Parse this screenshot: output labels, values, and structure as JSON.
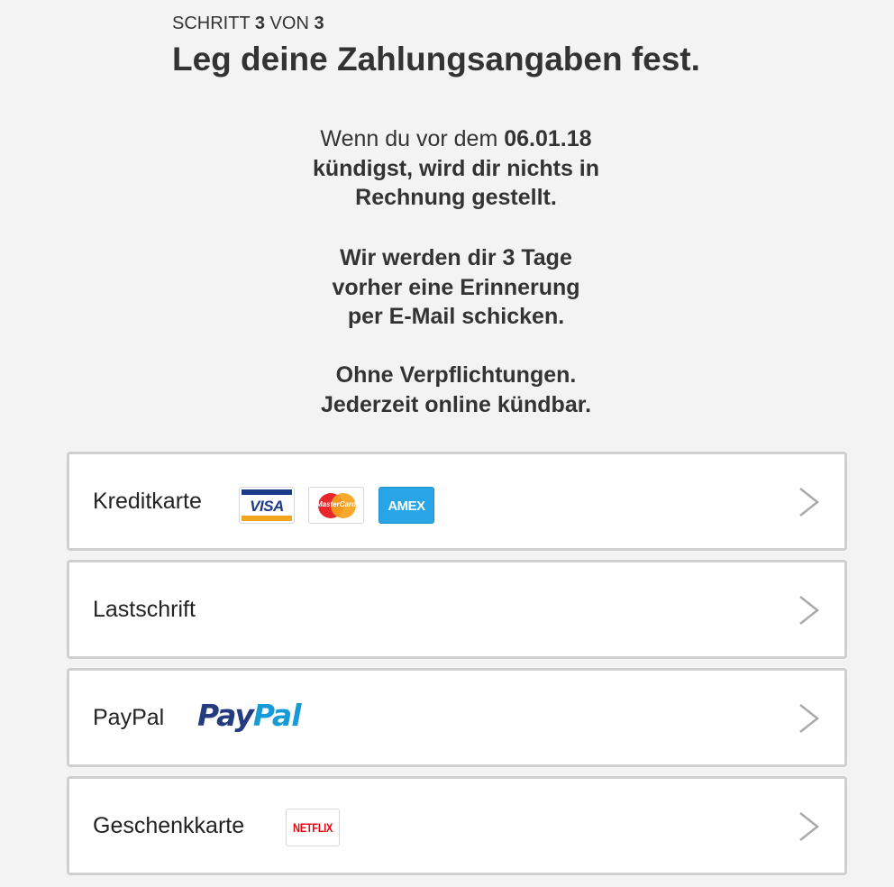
{
  "header": {
    "step_prefix": "SCHRITT ",
    "step_current": "3",
    "step_middle": " VON ",
    "step_total": "3",
    "title": "Leg deine Zahlungsangaben fest."
  },
  "info": {
    "line1_pre": "Wenn du vor dem ",
    "line1_date": "06.01.18",
    "line2": "kündigst, wird dir nichts in",
    "line3": "Rechnung gestellt.",
    "reminder_line1": "Wir werden dir 3 Tage",
    "reminder_line2": "vorher eine Erinnerung",
    "reminder_line3": "per E-Mail schicken.",
    "commit_line1": "Ohne Verpflichtungen.",
    "commit_line2": "Jederzeit online kündbar."
  },
  "payment_options": [
    {
      "label": "Kreditkarte",
      "logos": [
        {
          "icon": "visa-logo",
          "text": "VISA"
        },
        {
          "icon": "mastercard-logo",
          "text": "MasterCard"
        },
        {
          "icon": "amex-logo",
          "text": "AMEX"
        }
      ],
      "chevron_icon": "chevron-right-icon"
    },
    {
      "label": "Lastschrift",
      "chevron_icon": "chevron-right-icon"
    },
    {
      "label": "PayPal",
      "logo": {
        "icon": "paypal-logo",
        "text_part1": "Pay",
        "text_part2": "Pal"
      },
      "chevron_icon": "chevron-right-icon"
    },
    {
      "label": "Geschenkkarte",
      "logo": {
        "icon": "netflix-logo",
        "text": "NETFLIX"
      },
      "chevron_icon": "chevron-right-icon"
    }
  ],
  "colors": {
    "background": "#f3f3f3",
    "card_border": "#cfcfcf",
    "text": "#333333",
    "chevron": "#a9a9a9",
    "paypal_dark": "#253b80",
    "paypal_light": "#179bd7",
    "netflix_red": "#e50914",
    "amex_blue": "#27a5e7"
  }
}
